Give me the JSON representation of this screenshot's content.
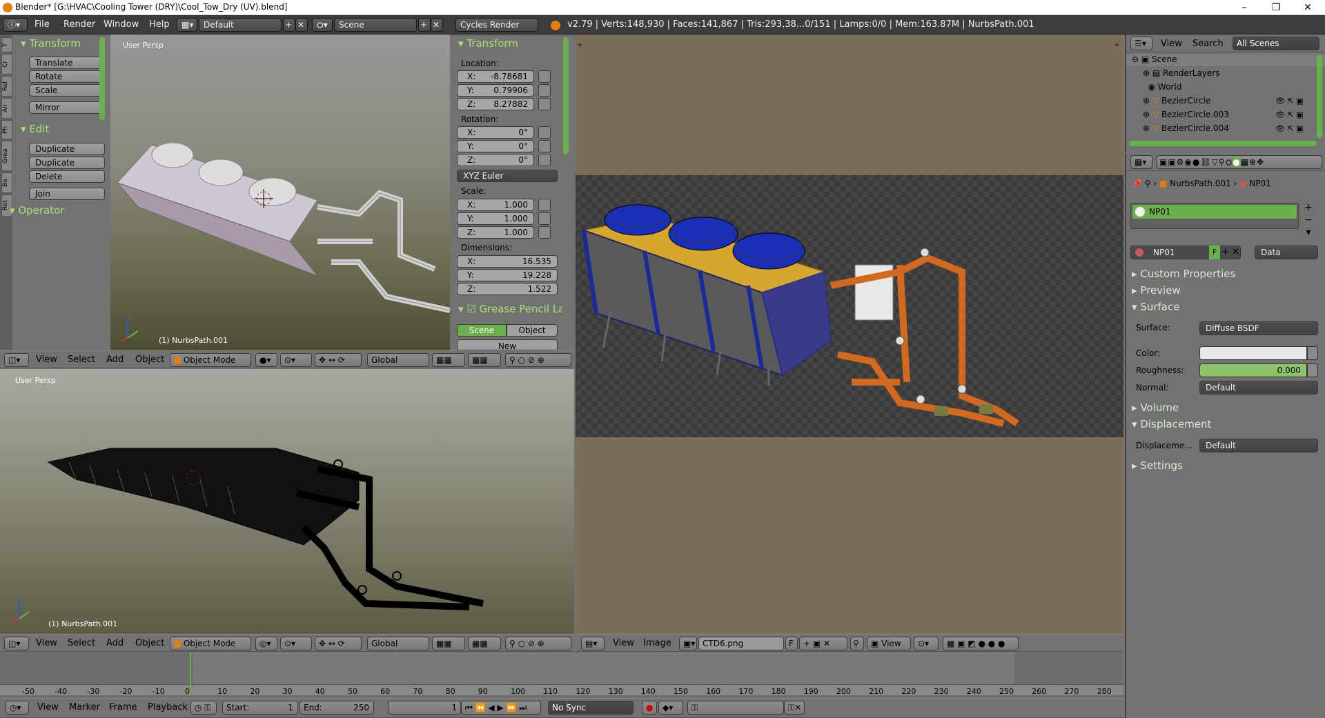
{
  "window": {
    "title": "Blender* [G:\\HVAC\\Cooling Tower (DRY)\\Cool_Tow_Dry (UV).blend]",
    "minimize": "–",
    "maximize": "❐",
    "close": "✕"
  },
  "infobar": {
    "menus": [
      "File",
      "Render",
      "Window",
      "Help"
    ],
    "layout": "Default",
    "scene": "Scene",
    "engine": "Cycles Render",
    "stats": "v2.79 | Verts:148,930 | Faces:141,867 | Tris:293,38...0/151 | Lamps:0/0 | Mem:163.87M | NurbsPath.001"
  },
  "toolshelf": {
    "tabs": [
      "T",
      "Cr",
      "Rel",
      "An",
      "Ph",
      "Grea",
      "Bo",
      "Ret"
    ],
    "transform_title": "Transform",
    "transform_buttons": [
      "Translate",
      "Rotate",
      "Scale",
      "Mirror"
    ],
    "edit_title": "Edit",
    "edit_buttons": [
      "Duplicate",
      "Duplicate Linked",
      "Delete",
      "Join"
    ],
    "operator_title": "Operator"
  },
  "viewport_top": {
    "label": "User Persp",
    "object": "(1) NurbsPath.001"
  },
  "npanel": {
    "transform_title": "Transform",
    "location_label": "Location:",
    "location": [
      {
        "k": "X:",
        "v": "-8.78681"
      },
      {
        "k": "Y:",
        "v": "0.79906"
      },
      {
        "k": "Z:",
        "v": "8.27882"
      }
    ],
    "rotation_label": "Rotation:",
    "rotation": [
      {
        "k": "X:",
        "v": "0°"
      },
      {
        "k": "Y:",
        "v": "0°"
      },
      {
        "k": "Z:",
        "v": "0°"
      }
    ],
    "rotation_mode": "XYZ Euler",
    "scale_label": "Scale:",
    "scale": [
      {
        "k": "X:",
        "v": "1.000"
      },
      {
        "k": "Y:",
        "v": "1.000"
      },
      {
        "k": "Z:",
        "v": "1.000"
      }
    ],
    "dimensions_label": "Dimensions:",
    "dimensions": [
      {
        "k": "X:",
        "v": "16.535"
      },
      {
        "k": "Y:",
        "v": "19.228"
      },
      {
        "k": "Z:",
        "v": "1.522"
      }
    ],
    "grease_title": "Grease Pencil La",
    "scene_btn": "Scene",
    "object_btn": "Object",
    "new_btn": "New"
  },
  "view3d_header": {
    "menus": [
      "View",
      "Select",
      "Add",
      "Object"
    ],
    "mode": "Object Mode",
    "orientation": "Global"
  },
  "viewport_bottom": {
    "label": "User Persp",
    "object": "(1) NurbsPath.001"
  },
  "image_header": {
    "menus": [
      "View",
      "Image"
    ],
    "image": "CTD6.png",
    "fake": "F",
    "view": "View"
  },
  "outliner": {
    "view": "View",
    "search": "Search",
    "filter": "All Scenes",
    "items": [
      {
        "name": "Scene",
        "indent": 0
      },
      {
        "name": "RenderLayers",
        "indent": 1
      },
      {
        "name": "World",
        "indent": 1
      },
      {
        "name": "BezierCircle",
        "indent": 1
      },
      {
        "name": "BezierCircle.003",
        "indent": 1
      },
      {
        "name": "BezierCircle.004",
        "indent": 1
      }
    ]
  },
  "properties": {
    "breadcrumb_object": "NurbsPath.001",
    "breadcrumb_material": "NP01",
    "slot": "NP01",
    "material_name": "NP01",
    "fake": "F",
    "link": "Data",
    "sections": {
      "custom": "Custom Properties",
      "preview": "Preview",
      "surface": "Surface",
      "volume": "Volume",
      "displacement": "Displacement",
      "settings": "Settings"
    },
    "surface_label": "Surface:",
    "surface_value": "Diffuse BSDF",
    "color_label": "Color:",
    "roughness_label": "Roughness:",
    "roughness_value": "0.000",
    "roughness_fraction": 0.0,
    "normal_label": "Normal:",
    "normal_value": "Default",
    "displacement_label": "Displaceme...",
    "displacement_value": "Default"
  },
  "timeline": {
    "ticks": [
      "-50",
      "-40",
      "-30",
      "-20",
      "-10",
      "0",
      "10",
      "20",
      "30",
      "40",
      "50",
      "60",
      "70",
      "80",
      "90",
      "100",
      "110",
      "120",
      "130",
      "140",
      "150",
      "160",
      "170",
      "180",
      "190",
      "200",
      "210",
      "220",
      "230",
      "240",
      "250",
      "260",
      "270",
      "280"
    ],
    "current_frame": 0
  },
  "timeline_header": {
    "menus": [
      "View",
      "Marker",
      "Frame",
      "Playback"
    ],
    "start_label": "Start:",
    "start": "1",
    "end_label": "End:",
    "end": "250",
    "frame": "1",
    "sync": "No Sync"
  },
  "colors": {
    "green_text": "#a5e36f",
    "active_green": "#6ab04c",
    "orange": "#e87d0d"
  }
}
